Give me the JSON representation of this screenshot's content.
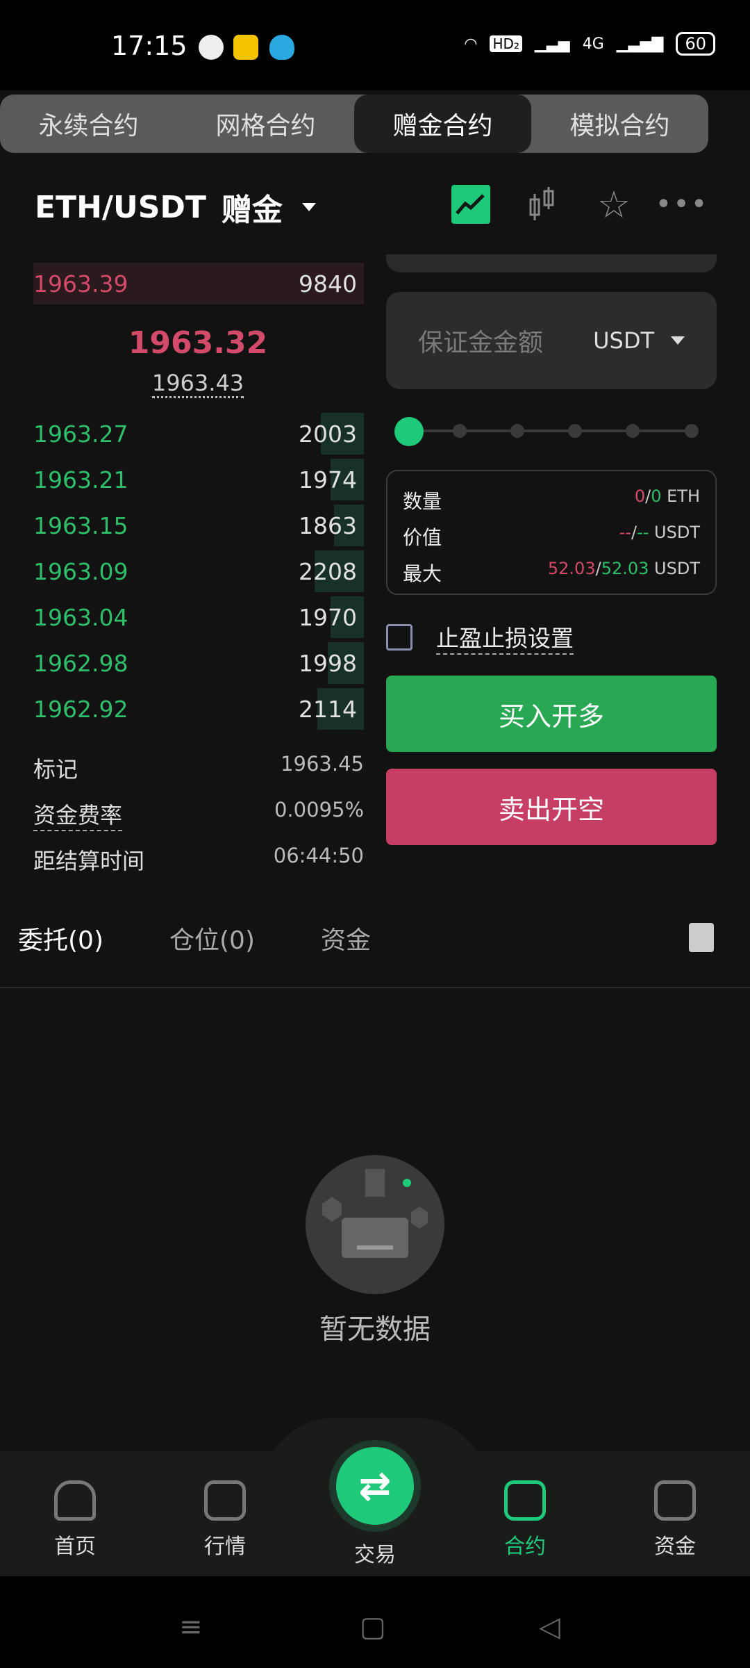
{
  "status_bar": {
    "time": "17:15",
    "network": "HD₂",
    "signal_label": "4G",
    "battery": "60"
  },
  "tabs": [
    "永续合约",
    "网格合约",
    "赠金合约",
    "模拟合约"
  ],
  "pair": {
    "symbol": "ETH/USDT",
    "mode": "赠金"
  },
  "order_book": {
    "ask": {
      "price": "1963.39",
      "qty": "9840"
    },
    "last_price": "1963.32",
    "mark_sub": "1963.43",
    "bids": [
      {
        "price": "1963.27",
        "qty": "2003"
      },
      {
        "price": "1963.21",
        "qty": "1974"
      },
      {
        "price": "1963.15",
        "qty": "1863"
      },
      {
        "price": "1963.09",
        "qty": "2208"
      },
      {
        "price": "1963.04",
        "qty": "1970"
      },
      {
        "price": "1962.98",
        "qty": "1998"
      },
      {
        "price": "1962.92",
        "qty": "2114"
      }
    ],
    "depth_fraction": [
      0.13,
      0.1,
      0.09,
      0.15,
      0.1,
      0.11,
      0.14
    ]
  },
  "info": {
    "mark_label": "标记",
    "mark_value": "1963.45",
    "funding_label": "资金费率",
    "funding_value": "0.0095%",
    "settle_label": "距结算时间",
    "settle_value": "06:44:50"
  },
  "order_form": {
    "margin_placeholder": "保证金金额",
    "margin_unit": "USDT",
    "slider_level": 0,
    "qty_label": "数量",
    "qty_a": "0",
    "qty_b": "0",
    "qty_unit": "ETH",
    "value_label": "价值",
    "value_a": "--",
    "value_b": "--",
    "value_unit": "USDT",
    "max_label": "最大",
    "max_a": "52.03",
    "max_b": "52.03",
    "max_unit": "USDT",
    "tp_sl_label": "止盈止损设置",
    "buy_label": "买入开多",
    "sell_label": "卖出开空"
  },
  "sub_tabs": [
    "委托(0)",
    "仓位(0)",
    "资金"
  ],
  "empty_text": "暂无数据",
  "bottom_nav": [
    "首页",
    "行情",
    "交易",
    "合约",
    "资金"
  ],
  "colors": {
    "green": "#1fc97a",
    "red": "#d44a6a",
    "buy": "#28a852",
    "sell": "#c63e64"
  }
}
